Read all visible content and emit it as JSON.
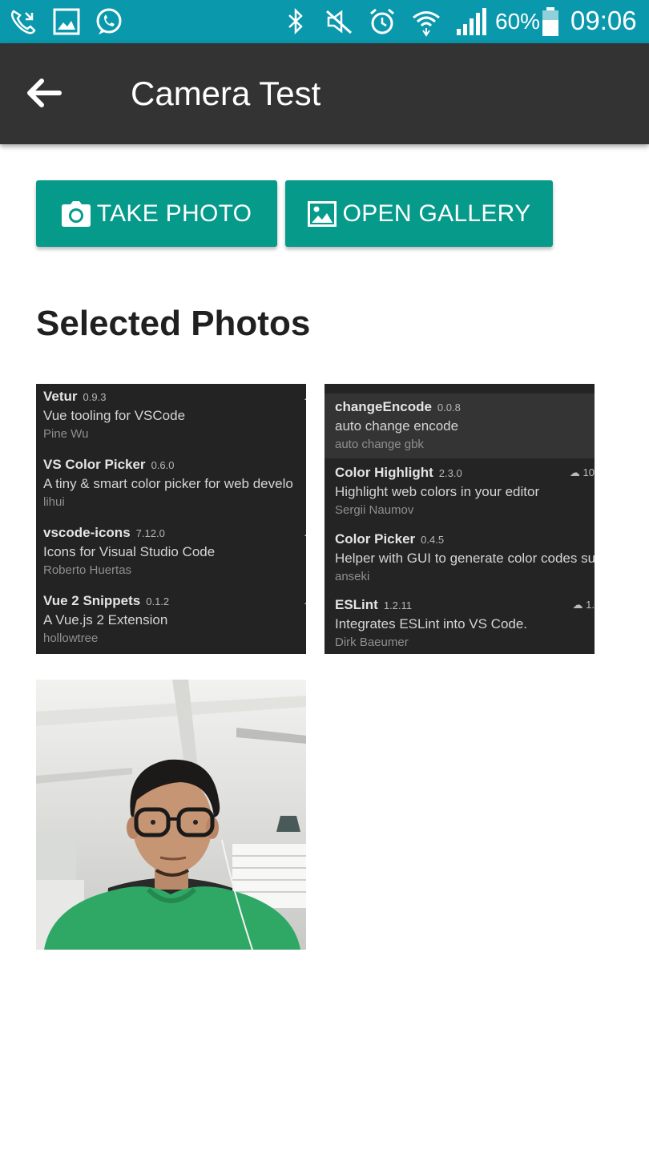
{
  "status_bar": {
    "battery": "60%",
    "time": "09:06",
    "icons": [
      "missed-call-icon",
      "gallery-icon",
      "whatsapp-icon",
      "bluetooth-icon",
      "mute-icon",
      "alarm-icon",
      "wifi-icon",
      "signal-icon",
      "battery-icon"
    ]
  },
  "app_bar": {
    "back_icon": "arrow-left-icon",
    "title": "Camera Test"
  },
  "actions": {
    "take_photo": "TAKE PHOTO",
    "open_gallery": "OPEN GALLERY"
  },
  "section_title": "Selected Photos",
  "photos": [
    {
      "extensions": [
        {
          "name": "Vetur",
          "version": "0.9.3",
          "description": "Vue tooling for VSCode",
          "author": "Pine Wu"
        },
        {
          "name": "VS Color Picker",
          "version": "0.6.0",
          "description": "A tiny & smart color picker for web develo",
          "author": "lihui"
        },
        {
          "name": "vscode-icons",
          "version": "7.12.0",
          "description": "Icons for Visual Studio Code",
          "author": "Roberto Huertas"
        },
        {
          "name": "Vue 2 Snippets",
          "version": "0.1.2",
          "description": "A Vue.js 2 Extension",
          "author": "hollowtree"
        }
      ]
    },
    {
      "extensions": [
        {
          "name": "changeEncode",
          "version": "0.0.8",
          "description": "auto change encode",
          "author": "auto change gbk"
        },
        {
          "name": "Color Highlight",
          "version": "2.3.0",
          "description": "Highlight web colors in your editor",
          "author": "Sergii Naumov",
          "downloads": "10"
        },
        {
          "name": "Color Picker",
          "version": "0.4.5",
          "description": "Helper with GUI to generate color codes su",
          "author": "anseki"
        },
        {
          "name": "ESLint",
          "version": "1.2.11",
          "description": "Integrates ESLint into VS Code.",
          "author": "Dirk Baeumer",
          "downloads": "1."
        }
      ]
    },
    {
      "content": "selfie-photo"
    }
  ],
  "colors": {
    "status_bar": "#0a98ad",
    "app_bar": "#333333",
    "accent": "#069a8a"
  }
}
